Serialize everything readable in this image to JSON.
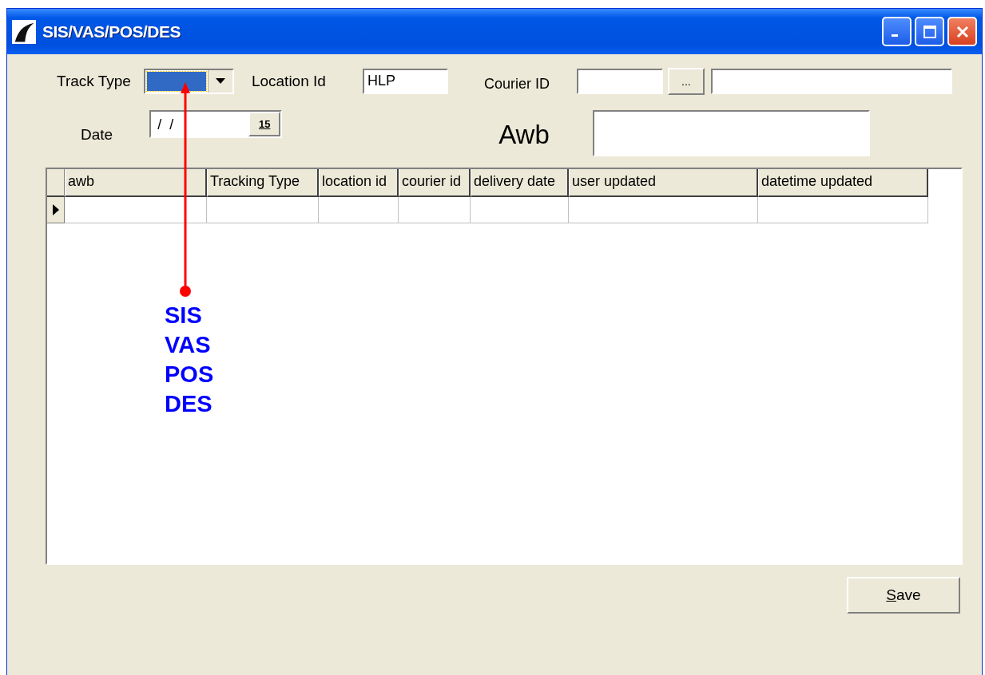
{
  "window": {
    "title": "SIS/VAS/POS/DES"
  },
  "form": {
    "track_type": {
      "label": "Track Type",
      "focused": true
    },
    "location_id": {
      "label": "Location Id",
      "value": "HLP"
    },
    "courier_id": {
      "label": "Courier ID",
      "browse": "..."
    },
    "date": {
      "label": "Date",
      "value": "/  /",
      "calendar": "15"
    },
    "awb": {
      "label": "Awb"
    }
  },
  "grid": {
    "columns": [
      "awb",
      "Tracking Type",
      "location id",
      "courier id",
      "delivery date",
      "user updated",
      "datetime updated"
    ],
    "rows": [
      {
        "current": true
      }
    ]
  },
  "buttons": [
    {
      "label": "Save"
    }
  ],
  "annotation": {
    "lines": [
      "SIS",
      "VAS",
      "POS",
      "DES"
    ]
  }
}
